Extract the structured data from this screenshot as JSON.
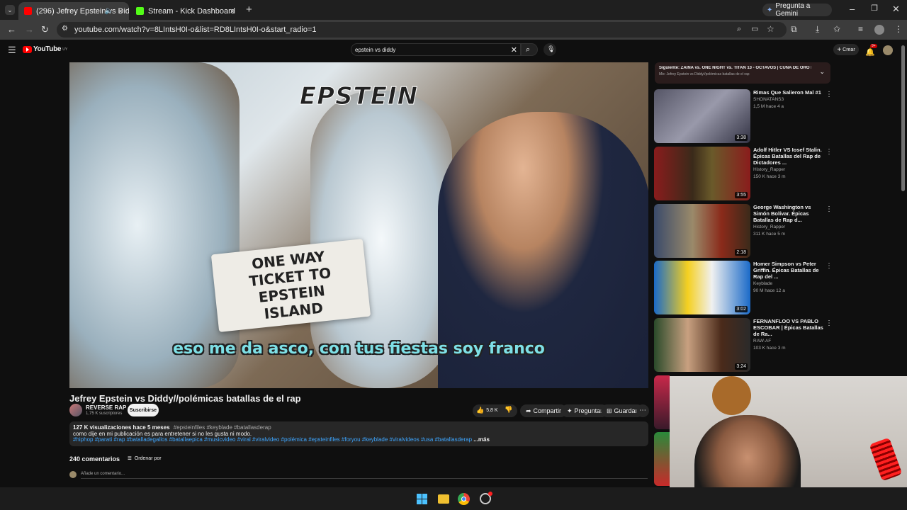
{
  "browser": {
    "tabs": [
      {
        "title": "(296) Jefrey Epstein vs Didd",
        "favicon_color": "#ff0000"
      },
      {
        "title": "Stream - Kick Dashboard",
        "favicon_color": "#53fc18"
      }
    ],
    "gemini_label": "Pregunta a Gemini",
    "url": "youtube.com/watch?v=8LIntsH0I-o&list=RD8LIntsH0I-o&start_radio=1"
  },
  "youtube": {
    "logo_text": "YouTube",
    "logo_sup": "UY",
    "search_query": "epstein vs diddy",
    "create_label": "Crear",
    "notif_count": "9+",
    "video": {
      "overlay_top": "EPSTEIN",
      "ticket_text": "ONE WAY TICKET TO EPSTEIN ISLAND",
      "subtitle": "eso me da asco, con tus fiestas soy franco"
    },
    "title": "Jefrey Epstein vs Diddy//polémicas batallas de el rap",
    "channel": {
      "name": "REVERSE RAP",
      "subs": "1,75 K suscriptores",
      "subscribe_label": "Suscribirse"
    },
    "actions": {
      "likes": "5,8 K",
      "share": "Compartir",
      "ask": "Preguntar",
      "save": "Guardar"
    },
    "description": {
      "stats": "127 K visualizaciones  hace 5 meses",
      "tags1": "#epsteinfiles #keyblade #batallasderap",
      "line2": "como dije en mi publicación es para entretener si no les gusta ni modo.",
      "tags2": "#hiphop #parati #rap #batalladegallos #batallaepica #musicvideo #viral #viralvideo #polémica #epsteinfiles #foryou #keyblade #viralvideos #usa #batallasderap",
      "more": "...más"
    },
    "comments": {
      "count": "240 comentarios",
      "sort_label": "Ordenar por",
      "placeholder": "Añade un comentario..."
    },
    "playlist": {
      "next": "Siguiente: ZAINA vs. ONE NIGHT vs. TITAN 13 - OCTAVOS | CUNA DE ORO N...",
      "mix": "Mix: Jefrey Epstein vs Diddy//polémicas batallas de el rap"
    },
    "related": [
      {
        "title": "Rimas Que Salieron Mal #1",
        "channel": "SHONATANS3",
        "stats": "1,5 M  hace 4 a",
        "duration": "3:38"
      },
      {
        "title": "Adolf Hitler VS Iosef Stalin. Épicas Batallas del Rap de Dictadores ...",
        "channel": "History_Rapper",
        "stats": "150 K  hace 3 m",
        "duration": "3:55"
      },
      {
        "title": "George Washington vs Simón Bolívar. Épicas Batallas de Rap d...",
        "channel": "History_Rapper",
        "stats": "311 K  hace 5 m",
        "duration": "2:18"
      },
      {
        "title": "Homer Simpson vs Peter Griffin. Épicas Batallas de Rap del ...",
        "channel": "Keyblade",
        "stats": "90 M  hace 12 a",
        "duration": "3:02"
      },
      {
        "title": "FERNANFLOO VS PABLO ESCOBAR | Épicas Batallas de Ra...",
        "channel": "RAW-AF",
        "stats": "103 K  hace 3 m",
        "duration": "3:24"
      }
    ]
  }
}
